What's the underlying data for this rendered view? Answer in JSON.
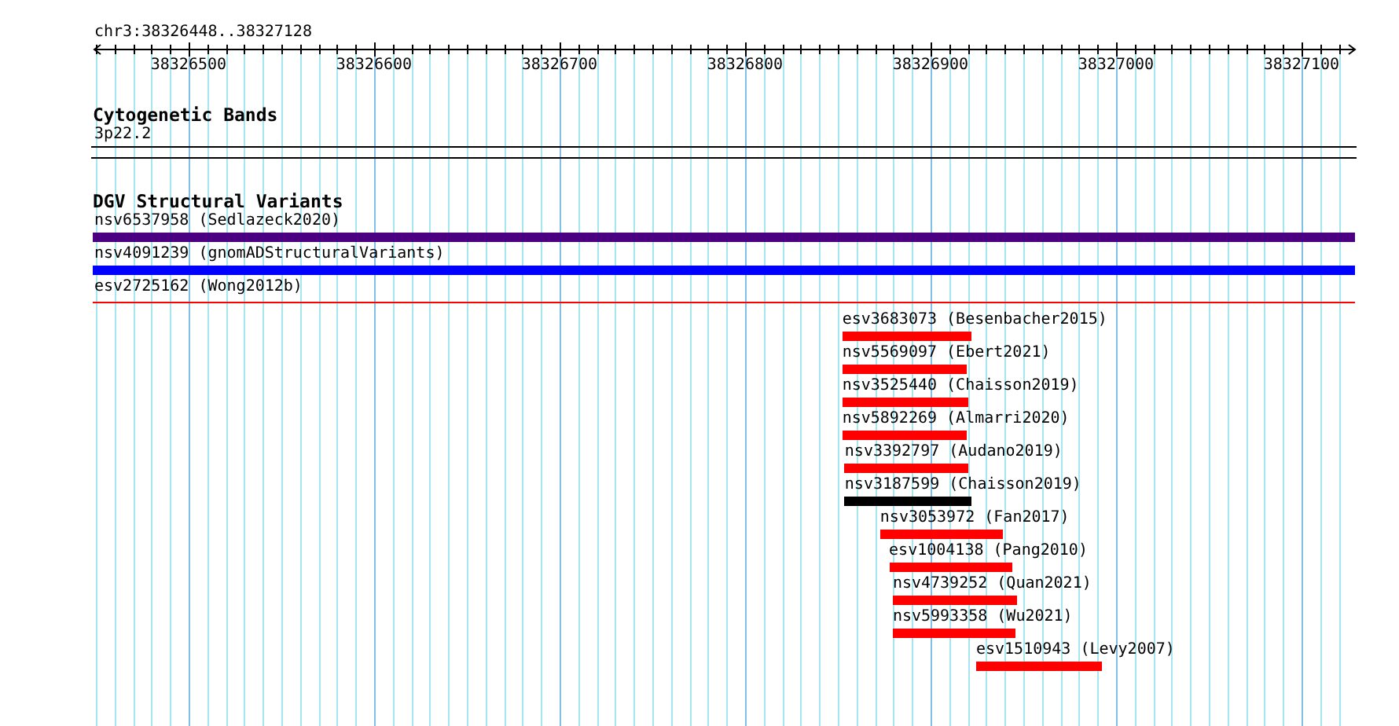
{
  "ruler": {
    "location": "chr3:38326448..38327128",
    "ticks": [
      "38326500",
      "38326600",
      "38326700",
      "38326800",
      "38326900",
      "38327000",
      "38327100"
    ]
  },
  "tracks": [
    {
      "title": "Cytogenetic Bands",
      "kind": "bands",
      "features": [
        {
          "label": "3p22.2"
        }
      ]
    },
    {
      "title": "DGV Structural Variants",
      "kind": "variants",
      "features": [
        {
          "label": "nsv6537958 (Sedlazeck2020)",
          "color": "#4b0082",
          "kind": "bar"
        },
        {
          "label": "nsv4091239 (gnomADStructuralVariants)",
          "color": "#0000ff",
          "kind": "bar"
        },
        {
          "label": "esv2725162 (Wong2012b)",
          "color": "#ff0000",
          "kind": "line"
        },
        {
          "label": "esv3683073 (Besenbacher2015)",
          "start": {
            "level": 0.594
          },
          "end": {
            "level": 0.696
          },
          "color": "#ff0000",
          "kind": "bar"
        },
        {
          "label": "nsv5569097 (Ebert2021)",
          "start": {
            "level": 0.594
          },
          "end": {
            "level": 0.693
          },
          "color": "#ff0000",
          "kind": "bar"
        },
        {
          "label": "nsv3525440 (Chaisson2019)",
          "start": {
            "level": 0.594
          },
          "end": {
            "level": 0.694
          },
          "color": "#ff0000",
          "kind": "bar"
        },
        {
          "label": "nsv5892269 (Almarri2020)",
          "start": {
            "level": 0.594
          },
          "end": {
            "level": 0.693
          },
          "color": "#ff0000",
          "kind": "bar"
        },
        {
          "label": "nsv3392797 (Audano2019)",
          "start": {
            "level": 0.596
          },
          "end": {
            "level": 0.694
          },
          "color": "#ff0000",
          "kind": "bar"
        },
        {
          "label": "nsv3187599 (Chaisson2019)",
          "start": {
            "level": 0.596
          },
          "end": {
            "level": 0.696
          },
          "color": "#000000",
          "kind": "bar"
        },
        {
          "label": "nsv3053972 (Fan2017)",
          "start": {
            "level": 0.624
          },
          "end": {
            "level": 0.721
          },
          "color": "#ff0000",
          "kind": "bar"
        },
        {
          "label": "esv1004138 (Pang2010)",
          "start": {
            "level": 0.631
          },
          "end": {
            "level": 0.729
          },
          "color": "#ff0000",
          "kind": "bar"
        },
        {
          "label": "nsv4739252 (Quan2021)",
          "start": {
            "level": 0.634
          },
          "end": {
            "level": 0.732
          },
          "color": "#ff0000",
          "kind": "bar"
        },
        {
          "label": "nsv5993358 (Wu2021)",
          "start": {
            "level": 0.634
          },
          "end": {
            "level": 0.731
          },
          "color": "#ff0000",
          "kind": "bar"
        },
        {
          "label": "esv1510943 (Levy2007)",
          "start": {
            "level": 0.7
          },
          "end": {
            "level": 0.8
          },
          "color": "#ff0000",
          "kind": "bar"
        }
      ]
    }
  ]
}
